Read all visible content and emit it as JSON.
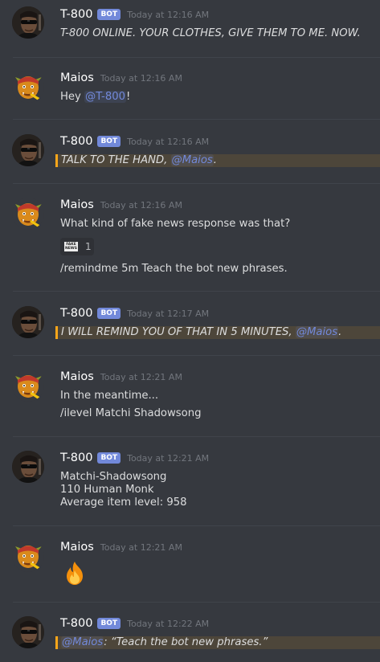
{
  "messages": [
    {
      "author": "T-800",
      "bot_tag": "BOT",
      "time": "Today at 12:16 AM",
      "text": "T-800 ONLINE. YOUR CLOTHES, GIVE THEM TO ME. NOW."
    },
    {
      "author": "Maios",
      "time": "Today at 12:16 AM",
      "text_before": "Hey ",
      "mention": "@T-800",
      "text_after": "!"
    },
    {
      "author": "T-800",
      "bot_tag": "BOT",
      "time": "Today at 12:16 AM",
      "text_before": "TALK TO THE HAND, ",
      "mention": "@Maios",
      "text_after": "."
    },
    {
      "author": "Maios",
      "time": "Today at 12:16 AM",
      "line1": "What kind of fake news response was that?",
      "reaction": {
        "emoji_text": "FAKE NEWS",
        "count": "1"
      },
      "line2": "/remindme 5m Teach the bot new phrases."
    },
    {
      "author": "T-800",
      "bot_tag": "BOT",
      "time": "Today at 12:17 AM",
      "text_before": "I WILL REMIND YOU OF THAT IN 5 MINUTES, ",
      "mention": "@Maios",
      "text_after": "."
    },
    {
      "author": "Maios",
      "time": "Today at 12:21 AM",
      "line1": "In the meantime...",
      "line2": "/ilevel Matchi Shadowsong"
    },
    {
      "author": "T-800",
      "bot_tag": "BOT",
      "time": "Today at 12:21 AM",
      "line1": "Matchi-Shadowsong",
      "line2": "110 Human Monk",
      "line3": "Average item level: 958"
    },
    {
      "author": "Maios",
      "time": "Today at 12:21 AM",
      "emoji": "fire-emoji"
    },
    {
      "author": "T-800",
      "bot_tag": "BOT",
      "time": "Today at 12:22 AM",
      "mention": "@Maios",
      "text_after": ": “Teach the bot new phrases.”"
    }
  ],
  "colors": {
    "background": "#36393f",
    "mention": "#7289da",
    "highlight_bar": "#faa61a",
    "bot_badge": "#7289da",
    "timestamp": "#72767d"
  }
}
